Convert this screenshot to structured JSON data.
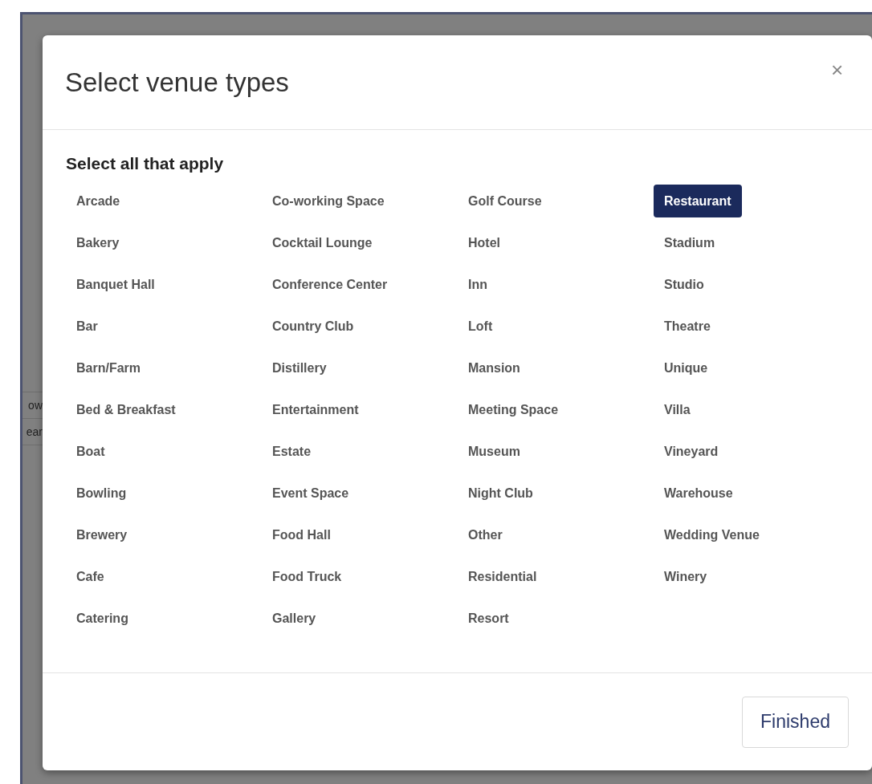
{
  "background_rows": [
    {
      "text": "ow"
    },
    {
      "text": "ear"
    }
  ],
  "dialog": {
    "title": "Select venue types",
    "close": "×",
    "heading": "Select all that apply",
    "columns": [
      [
        {
          "label": "Arcade",
          "selected": false
        },
        {
          "label": "Bakery",
          "selected": false
        },
        {
          "label": "Banquet Hall",
          "selected": false
        },
        {
          "label": "Bar",
          "selected": false
        },
        {
          "label": "Barn/Farm",
          "selected": false
        },
        {
          "label": "Bed & Breakfast",
          "selected": false
        },
        {
          "label": "Boat",
          "selected": false
        },
        {
          "label": "Bowling",
          "selected": false
        },
        {
          "label": "Brewery",
          "selected": false
        },
        {
          "label": "Cafe",
          "selected": false
        },
        {
          "label": "Catering",
          "selected": false
        }
      ],
      [
        {
          "label": "Co-working Space",
          "selected": false
        },
        {
          "label": "Cocktail Lounge",
          "selected": false
        },
        {
          "label": "Conference Center",
          "selected": false
        },
        {
          "label": "Country Club",
          "selected": false
        },
        {
          "label": "Distillery",
          "selected": false
        },
        {
          "label": "Entertainment",
          "selected": false
        },
        {
          "label": "Estate",
          "selected": false
        },
        {
          "label": "Event Space",
          "selected": false
        },
        {
          "label": "Food Hall",
          "selected": false
        },
        {
          "label": "Food Truck",
          "selected": false
        },
        {
          "label": "Gallery",
          "selected": false
        }
      ],
      [
        {
          "label": "Golf Course",
          "selected": false
        },
        {
          "label": "Hotel",
          "selected": false
        },
        {
          "label": "Inn",
          "selected": false
        },
        {
          "label": "Loft",
          "selected": false
        },
        {
          "label": "Mansion",
          "selected": false
        },
        {
          "label": "Meeting Space",
          "selected": false
        },
        {
          "label": "Museum",
          "selected": false
        },
        {
          "label": "Night Club",
          "selected": false
        },
        {
          "label": "Other",
          "selected": false
        },
        {
          "label": "Residential",
          "selected": false
        },
        {
          "label": "Resort",
          "selected": false
        }
      ],
      [
        {
          "label": "Restaurant",
          "selected": true
        },
        {
          "label": "Stadium",
          "selected": false
        },
        {
          "label": "Studio",
          "selected": false
        },
        {
          "label": "Theatre",
          "selected": false
        },
        {
          "label": "Unique",
          "selected": false
        },
        {
          "label": "Villa",
          "selected": false
        },
        {
          "label": "Vineyard",
          "selected": false
        },
        {
          "label": "Warehouse",
          "selected": false
        },
        {
          "label": "Wedding Venue",
          "selected": false
        },
        {
          "label": "Winery",
          "selected": false
        }
      ]
    ],
    "button": "Finished"
  }
}
